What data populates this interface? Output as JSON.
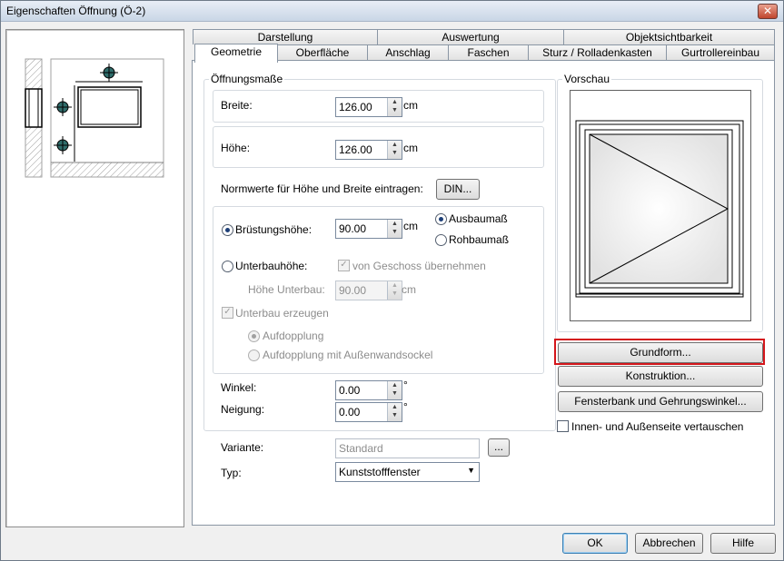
{
  "window": {
    "title": "Eigenschaften Öffnung (Ö-2)",
    "close_label": "✕"
  },
  "tabs": {
    "row1": [
      "Darstellung",
      "Auswertung",
      "Objektsichtbarkeit"
    ],
    "row2": [
      "Geometrie",
      "Oberfläche",
      "Anschlag",
      "Faschen",
      "Sturz / Rolladenkasten",
      "Gurtrollereinbau"
    ],
    "selected": "Geometrie"
  },
  "oeffnungsmasse": {
    "group_title": "Öffnungsmaße",
    "breite_label": "Breite:",
    "breite_value": "126.00",
    "breite_unit": "cm",
    "hoehe_label": "Höhe:",
    "hoehe_value": "126.00",
    "hoehe_unit": "cm",
    "normwerte_label": "Normwerte für Höhe und Breite eintragen:",
    "din_button": "DIN...",
    "bruestung_label": "Brüstungshöhe:",
    "bruestung_value": "90.00",
    "bruestung_unit": "cm",
    "ausbaumass_label": "Ausbaumaß",
    "rohbaumass_label": "Rohbaumaß",
    "unterbau_label": "Unterbauhöhe:",
    "von_geschoss_label": "von Geschoss übernehmen",
    "hoehe_unterbau_label": "Höhe Unterbau:",
    "hoehe_unterbau_value": "90.00",
    "hoehe_unterbau_unit": "cm",
    "unterbau_erzeugen_label": "Unterbau erzeugen",
    "aufdopplung_label": "Aufdopplung",
    "aufdopplung_sockel_label": "Aufdopplung mit Außenwandsockel",
    "winkel_label": "Winkel:",
    "winkel_value": "0.00",
    "winkel_unit": "°",
    "neigung_label": "Neigung:",
    "neigung_value": "0.00",
    "neigung_unit": "°"
  },
  "variante": {
    "label": "Variante:",
    "value": "Standard",
    "browse_label": "..."
  },
  "typ": {
    "label": "Typ:",
    "value": "Kunststofffenster"
  },
  "vorschau": {
    "group_title": "Vorschau"
  },
  "right_buttons": {
    "grundform": "Grundform...",
    "konstruktion": "Konstruktion...",
    "fensterbank": "Fensterbank und Gehrungswinkel...",
    "vertauschen_label": "Innen- und Außenseite vertauschen"
  },
  "footer": {
    "ok": "OK",
    "abbrechen": "Abbrechen",
    "hilfe": "Hilfe"
  },
  "colors": {
    "highlight": "#d4161b",
    "marker": "#2f6d6b"
  }
}
